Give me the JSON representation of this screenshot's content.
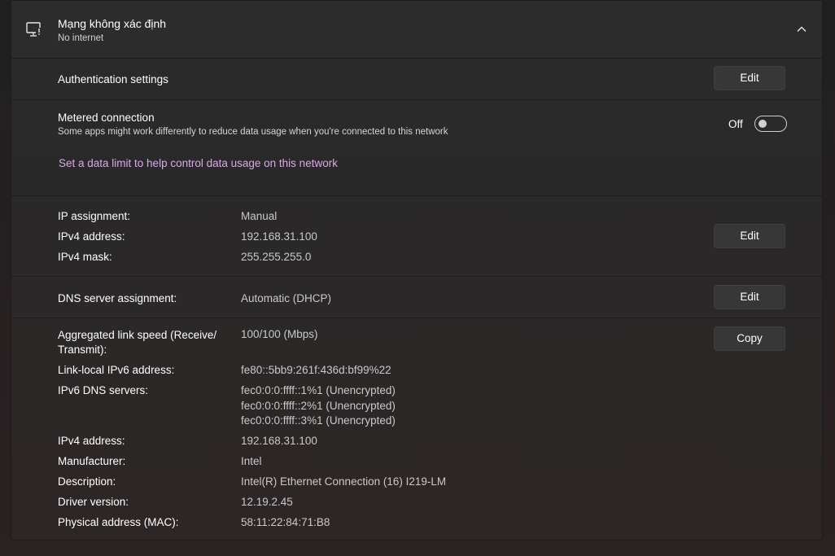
{
  "network": {
    "name": "Mạng không xác định",
    "status": "No internet"
  },
  "auth": {
    "label": "Authentication settings",
    "edit_label": "Edit"
  },
  "metered": {
    "title": "Metered connection",
    "description": "Some apps might work differently to reduce data usage when you're connected to this network",
    "toggle_state": "Off",
    "link": "Set a data limit to help control data usage on this network"
  },
  "ip": {
    "edit_label": "Edit",
    "rows": [
      {
        "label": "IP assignment:",
        "value": "Manual"
      },
      {
        "label": "IPv4 address:",
        "value": "192.168.31.100"
      },
      {
        "label": "IPv4 mask:",
        "value": "255.255.255.0"
      }
    ]
  },
  "dns": {
    "label": "DNS server assignment:",
    "value": "Automatic (DHCP)",
    "edit_label": "Edit"
  },
  "properties": {
    "copy_label": "Copy",
    "link_speed_label_line1": "Aggregated link speed (Receive/",
    "link_speed_label_line2": "Transmit):",
    "link_speed_value": "100/100 (Mbps)",
    "ipv6_label": "Link-local IPv6 address:",
    "ipv6_value": "fe80::5bb9:261f:436d:bf99%22",
    "ipv6_dns_label": "IPv6 DNS servers:",
    "ipv6_dns_values": [
      "fec0:0:0:ffff::1%1 (Unencrypted)",
      "fec0:0:0:ffff::2%1 (Unencrypted)",
      "fec0:0:0:ffff::3%1 (Unencrypted)"
    ],
    "ipv4_label": "IPv4 address:",
    "ipv4_value": "192.168.31.100",
    "manufacturer_label": "Manufacturer:",
    "manufacturer_value": "Intel",
    "description_label": "Description:",
    "description_value": "Intel(R) Ethernet Connection (16) I219-LM",
    "driver_label": "Driver version:",
    "driver_value": "12.19.2.45",
    "mac_label": "Physical address (MAC):",
    "mac_value": "58:11:22:84:71:B8"
  }
}
